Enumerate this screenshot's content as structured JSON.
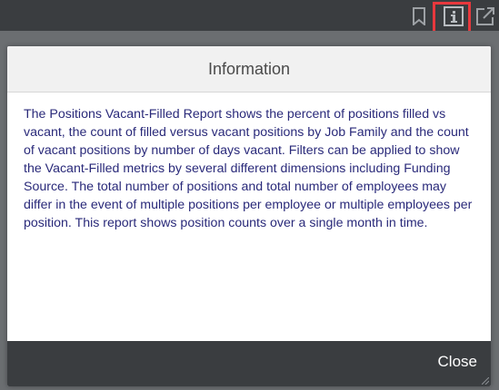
{
  "toolbar": {
    "icons": [
      "bookmark-icon",
      "info-icon",
      "share-icon"
    ],
    "highlight_color": "#e8383d"
  },
  "dialog": {
    "title": "Information",
    "body": "The Positions Vacant-Filled Report shows the percent of positions filled vs vacant, the count of filled versus vacant positions by Job Family and the count of vacant positions by number of days vacant. Filters can be applied to show the Vacant-Filled metrics by several different dimensions including Funding Source. The total number of positions and total number of employees may differ in the event of multiple positions per employee or multiple employees per position. This report shows position counts over a single month in time.",
    "close_label": "Close"
  },
  "colors": {
    "body_text": "#2a2a7a",
    "footer_bg": "#3a3d40",
    "header_bg": "#f1f1f1"
  }
}
